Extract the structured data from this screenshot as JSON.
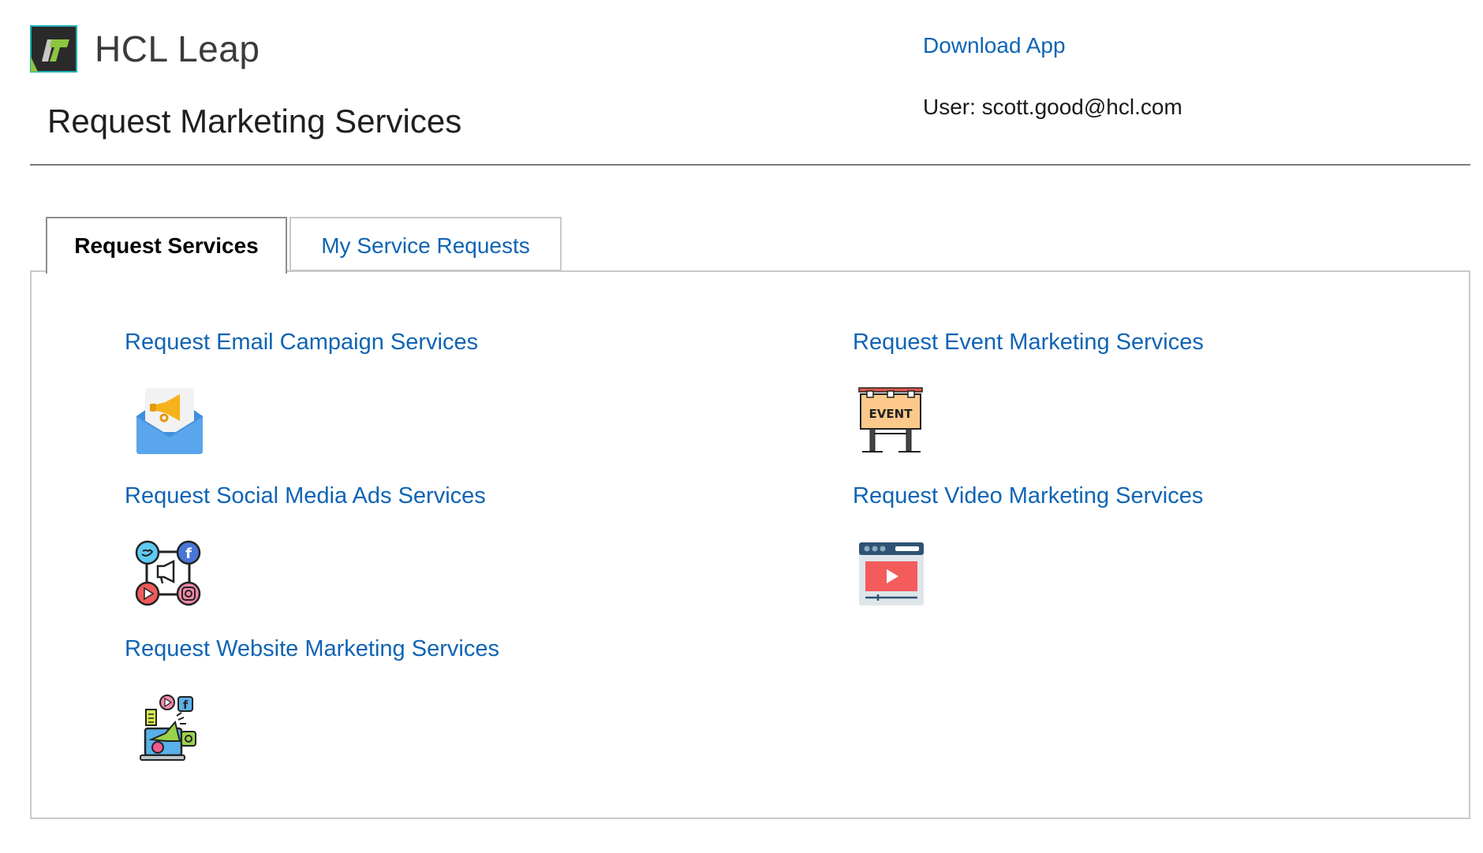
{
  "header": {
    "brand": "HCL Leap",
    "page_title": "Request Marketing Services",
    "download_label": "Download App",
    "user_label": "User: scott.good@hcl.com"
  },
  "tabs": [
    {
      "label": "Request Services",
      "active": true
    },
    {
      "label": "My Service Requests",
      "active": false
    }
  ],
  "services": [
    {
      "label": "Request Email Campaign Services",
      "icon": "email-campaign-icon"
    },
    {
      "label": "Request Event Marketing Services",
      "icon": "event-board-icon"
    },
    {
      "label": "Request Social Media Ads Services",
      "icon": "social-media-icon"
    },
    {
      "label": "Request Video Marketing Services",
      "icon": "video-player-icon"
    },
    {
      "label": "Request Website Marketing Services",
      "icon": "website-marketing-icon"
    }
  ],
  "event_sign_text": "EVENT",
  "colors": {
    "link": "#0f64b4",
    "logo_bg": "#2a2a2a",
    "logo_green": "#8cc63f",
    "logo_teal": "#1fb0b0"
  }
}
